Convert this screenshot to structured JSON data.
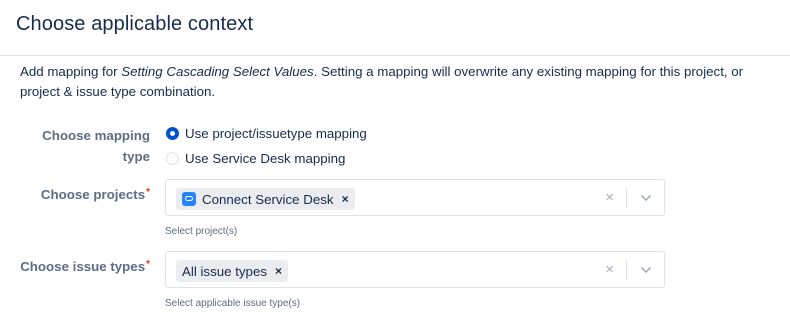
{
  "header": {
    "title": "Choose applicable context"
  },
  "description": {
    "prefix": "Add mapping for ",
    "emphasis": "Setting Cascading Select Values",
    "suffix": ". Setting a mapping will overwrite any existing mapping for this project, or project & issue type combination."
  },
  "mapping_type": {
    "label_line1": "Choose mapping",
    "label_line2": "type",
    "options": [
      {
        "label": "Use project/issuetype mapping",
        "checked": true
      },
      {
        "label": "Use Service Desk mapping",
        "checked": false
      }
    ]
  },
  "projects": {
    "label": "Choose projects",
    "required_mark": "*",
    "selected": [
      {
        "label": "Connect Service Desk",
        "icon": "project-icon",
        "remove": "×"
      }
    ],
    "clear": "×",
    "helper": "Select project(s)"
  },
  "issue_types": {
    "label": "Choose issue types",
    "required_mark": "*",
    "selected": [
      {
        "label": "All issue types",
        "remove": "×"
      }
    ],
    "clear": "×",
    "helper": "Select applicable issue type(s)"
  },
  "colors": {
    "primary": "#0052cc",
    "text": "#172b4d",
    "subtle_text": "#5e6c84",
    "required": "#de350b",
    "border": "#dfe1e6",
    "tag_bg": "#ebecf0"
  }
}
